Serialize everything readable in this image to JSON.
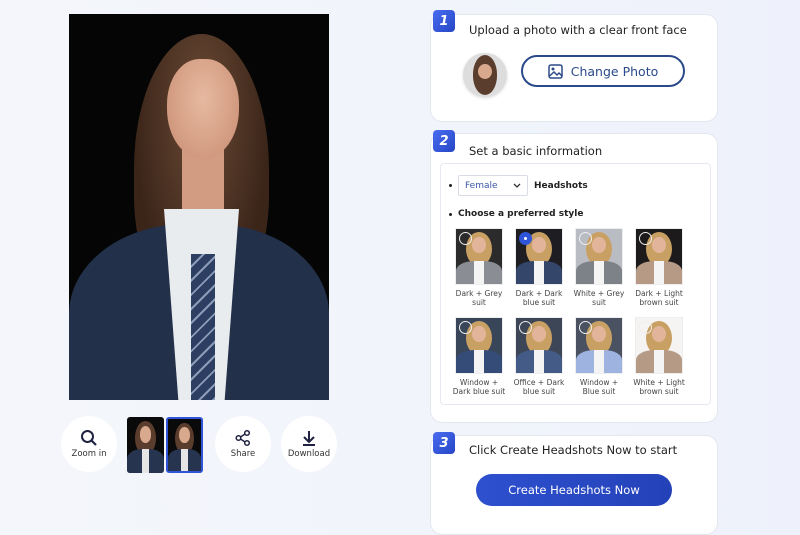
{
  "preview": {
    "actions": [
      {
        "label": "Zoom in",
        "icon": "zoom-in-icon"
      },
      {
        "label": "Share",
        "icon": "share-icon"
      },
      {
        "label": "Download",
        "icon": "download-icon"
      }
    ],
    "thumbnails_selected_index": 1
  },
  "step1": {
    "number": "1",
    "title": "Upload a photo with a clear front face",
    "button": "Change Photo"
  },
  "step2": {
    "number": "2",
    "title": "Set a basic information",
    "gender": "Female",
    "headshots_label": "Headshots",
    "style_label": "Choose a preferred style",
    "styles": [
      {
        "label": "Dark + Grey suit",
        "bg": "#2b2b2b",
        "suit": "#8a8d93",
        "selected": false
      },
      {
        "label": "Dark + Dark blue suit",
        "bg": "#1e1e22",
        "suit": "#34466a",
        "selected": true
      },
      {
        "label": "White + Grey suit",
        "bg": "#b9bcc2",
        "suit": "#7d8188",
        "selected": false
      },
      {
        "label": "Dark + Light brown suit",
        "bg": "#1c1a1a",
        "suit": "#b69a86",
        "selected": false
      },
      {
        "label": "Window + Dark blue suit",
        "bg": "#39465a",
        "suit": "#354c78",
        "selected": false
      },
      {
        "label": "Office + Dark blue suit",
        "bg": "#3d4656",
        "suit": "#435b86",
        "selected": false
      },
      {
        "label": "Window + Blue suit",
        "bg": "#4a5262",
        "suit": "#9fb3e0",
        "selected": false
      },
      {
        "label": "White + Light brown suit",
        "bg": "#f6f4f2",
        "suit": "#b59a85",
        "selected": false
      }
    ]
  },
  "step3": {
    "number": "3",
    "title": "Click Create Headshots Now to start",
    "button": "Create Headshots Now"
  },
  "colors": {
    "accent": "#2f54d8",
    "outline": "#2a4a8a"
  }
}
